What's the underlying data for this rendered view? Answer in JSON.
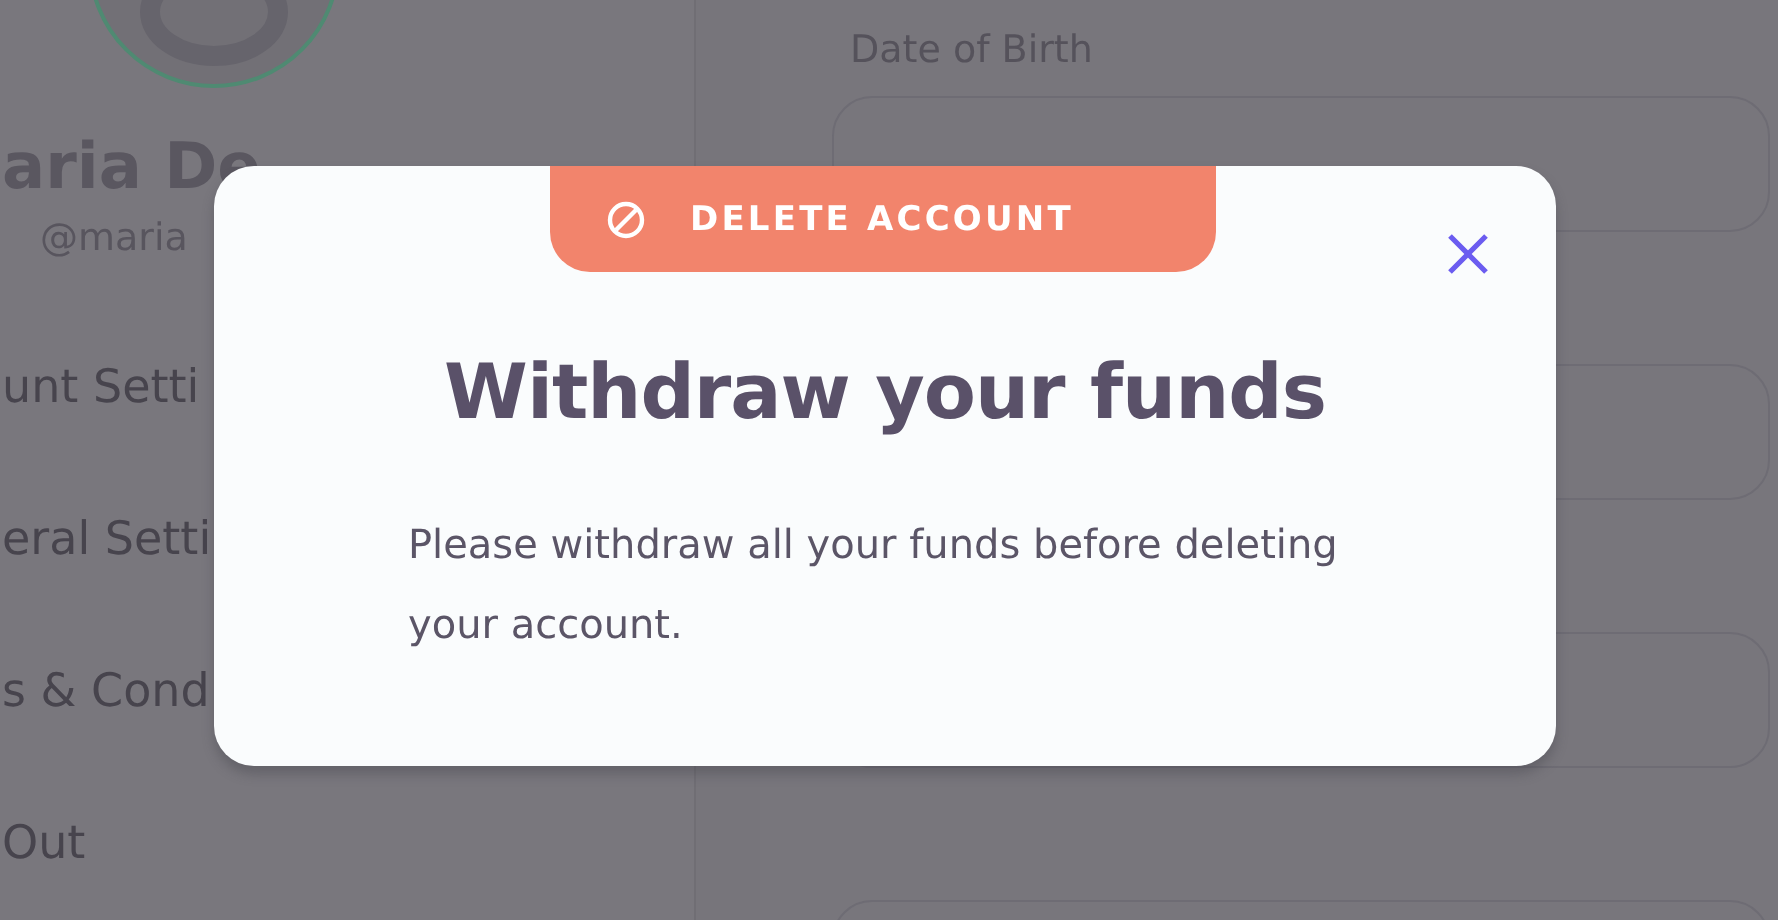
{
  "sidebar": {
    "name": "aria De",
    "handle": "@maria",
    "items": [
      {
        "label": "unt Setti"
      },
      {
        "label": "eral Setti"
      },
      {
        "label": "s & Cond"
      },
      {
        "label": "Out"
      }
    ]
  },
  "main": {
    "date_of_birth_label": "Date of Birth"
  },
  "dialog": {
    "tab": "DELETE ACCOUNT",
    "title": "Withdraw your funds",
    "body": "Please withdraw all your funds before deleting your account."
  }
}
